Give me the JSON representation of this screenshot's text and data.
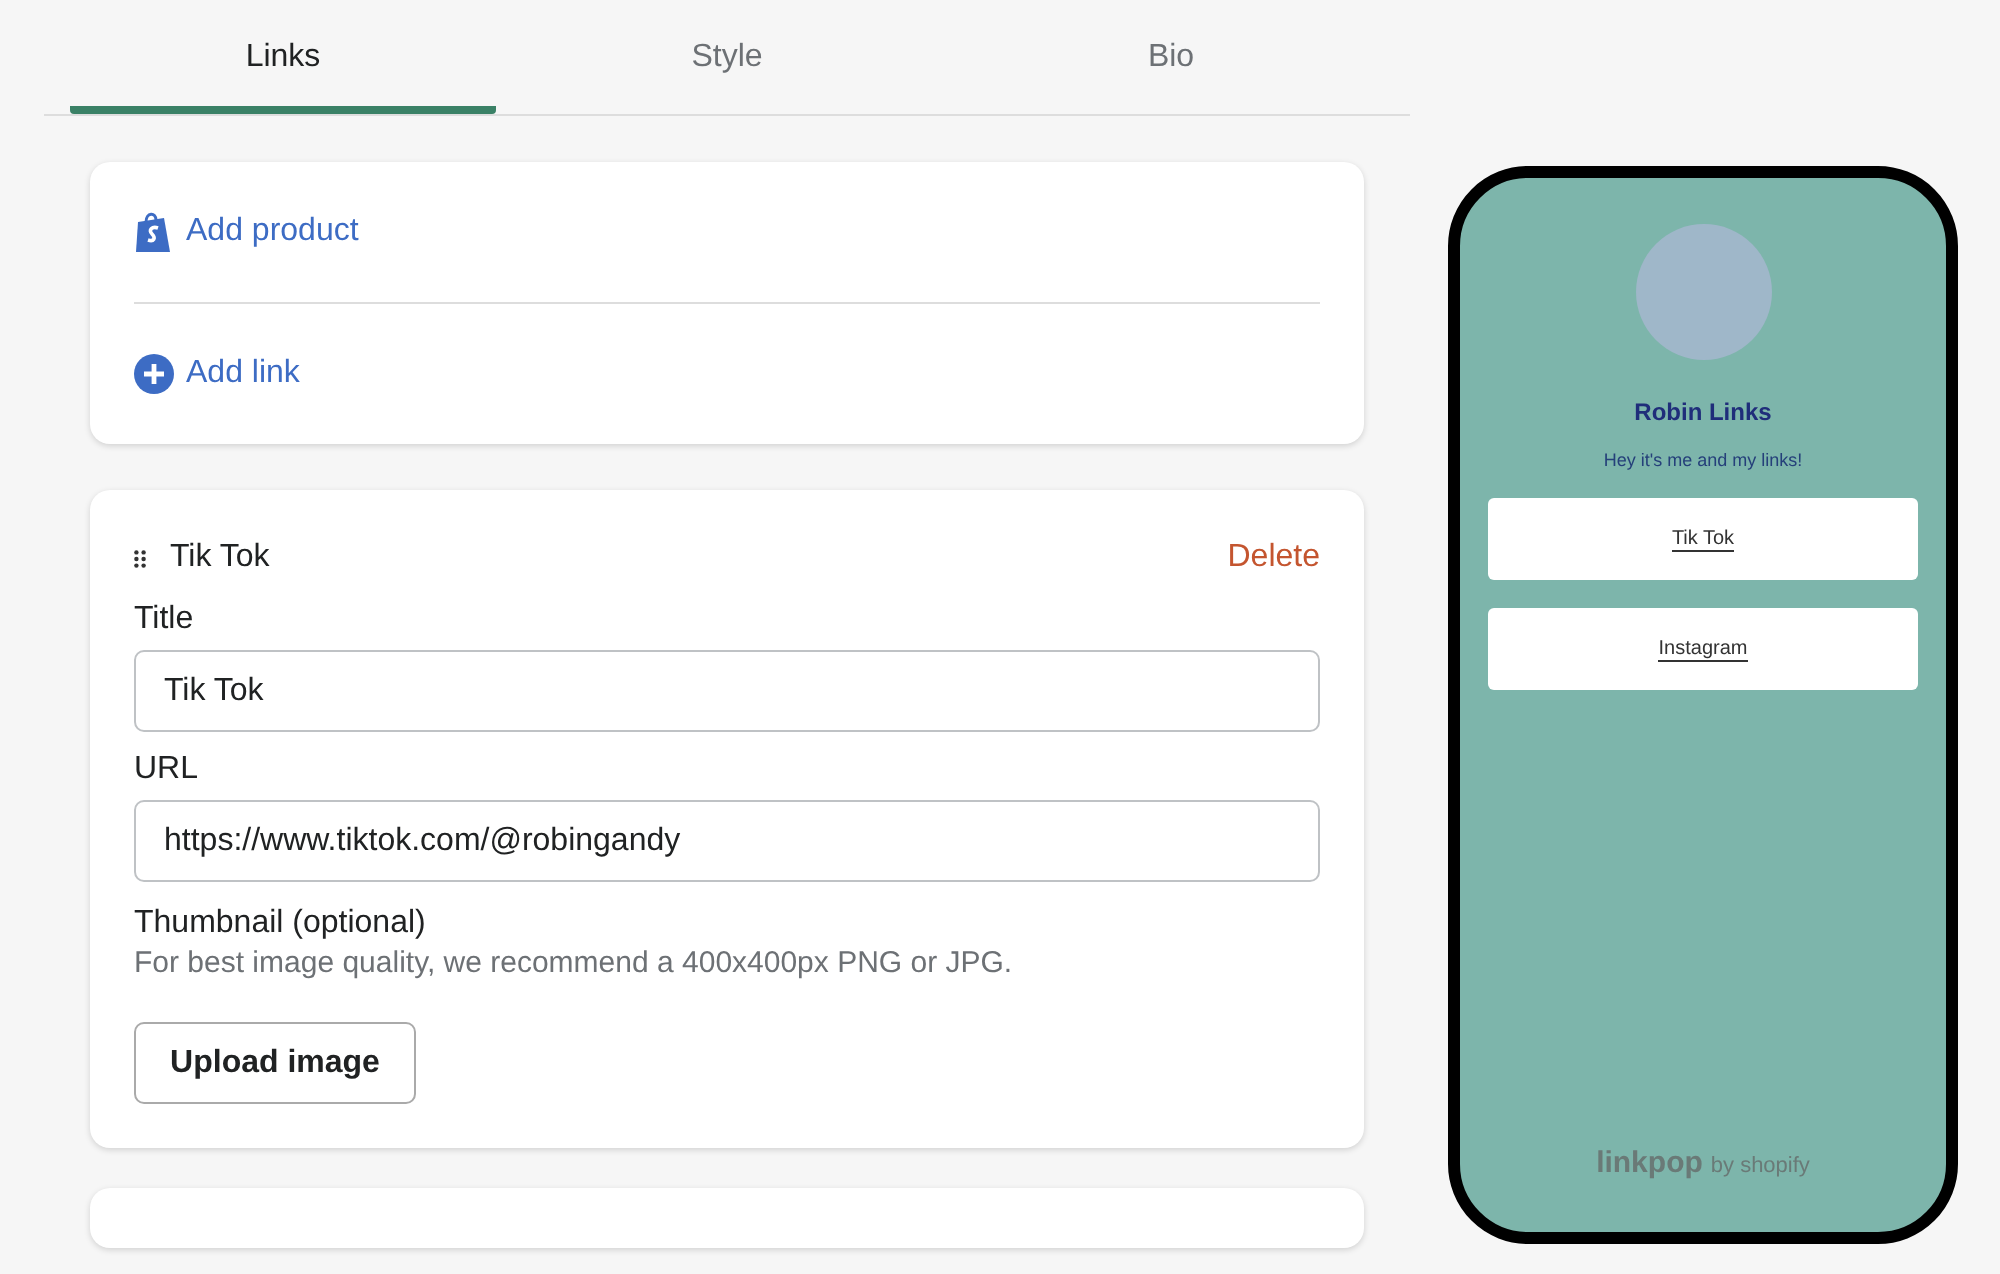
{
  "tabs": [
    {
      "label": "Links",
      "selected": true
    },
    {
      "label": "Style",
      "selected": false
    },
    {
      "label": "Bio",
      "selected": false
    }
  ],
  "add_card": {
    "actions": [
      {
        "kind": "product",
        "label": "Add product"
      },
      {
        "kind": "link",
        "label": "Add link"
      }
    ]
  },
  "link_editor": {
    "name": "Tik Tok",
    "delete": "Delete",
    "fields": [
      {
        "label": "Title",
        "value": "Tik Tok"
      },
      {
        "label": "URL",
        "value": "https://www.tiktok.com/@robingandy"
      }
    ],
    "thumbnail": {
      "label": "Thumbnail (optional)",
      "hint": "For best image quality, we recommend a 400x400px PNG or JPG.",
      "button": "Upload image"
    }
  },
  "preview": {
    "name": "Robin Links",
    "bio": "Hey it's me and my links!",
    "links": [
      "Tik Tok",
      "Instagram"
    ],
    "brand": "linkpop",
    "brand_suffix": "by shopify"
  }
}
